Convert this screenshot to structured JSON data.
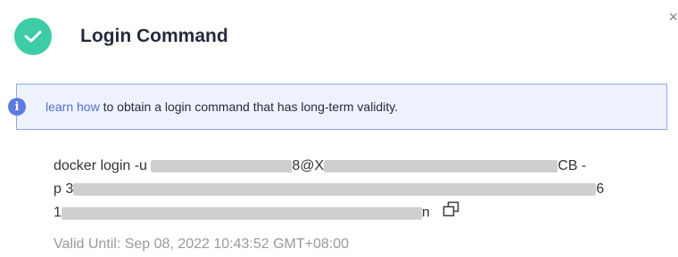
{
  "dialog": {
    "close_glyph": "×",
    "title": "Login Command"
  },
  "notice": {
    "info_glyph": "i",
    "link_text": "learn how",
    "text": " to obtain a login command that has long-term validity."
  },
  "command": {
    "line1_prefix": "docker login -u ",
    "line1_middle": "8@X",
    "line1_suffix": "CB -",
    "line2_prefix": "p 3",
    "line2_suffix": "6",
    "line3_prefix": "1",
    "line3_suffix": "n"
  },
  "validity": {
    "text": "Valid Until: Sep 08, 2022 10:43:52 GMT+08:00"
  },
  "icons": {
    "success": "check-circle-icon",
    "info": "info-circle-icon",
    "copy": "copy-icon",
    "close": "close-icon"
  },
  "colors": {
    "success": "#3dcca6",
    "info_border": "#8ea8e8",
    "info_bg": "#eef2fd",
    "link": "#526ecc",
    "muted": "#9a9a9a"
  }
}
